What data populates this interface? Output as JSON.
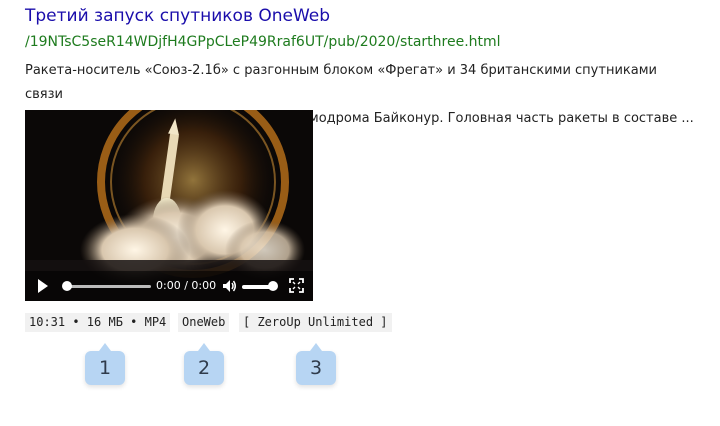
{
  "result": {
    "title": "Третий запуск спутников OneWeb",
    "url": "/19NTsC5seR14WDjfH4GPpCLeP49Rraf6UT/pub/2020/starthree.html",
    "snippet_line1": "Ракета-носитель «Союз-2.1б» с разгонным блоком «Фрегат» и 34 британскими спутниками связи",
    "snippet_line2": "OneWeb стартовала с 31-й площадки космодрома Байконур. Головная часть ракеты в составе ..."
  },
  "video": {
    "time_display": "0:00 / 0:00",
    "progress": 0,
    "volume_level": 0.85
  },
  "meta": {
    "info": "10:31 • 16 МБ • MP4",
    "source": "OneWeb",
    "license": "[ ZeroUp Unlimited ]"
  },
  "callouts": [
    "1",
    "2",
    "3"
  ]
}
